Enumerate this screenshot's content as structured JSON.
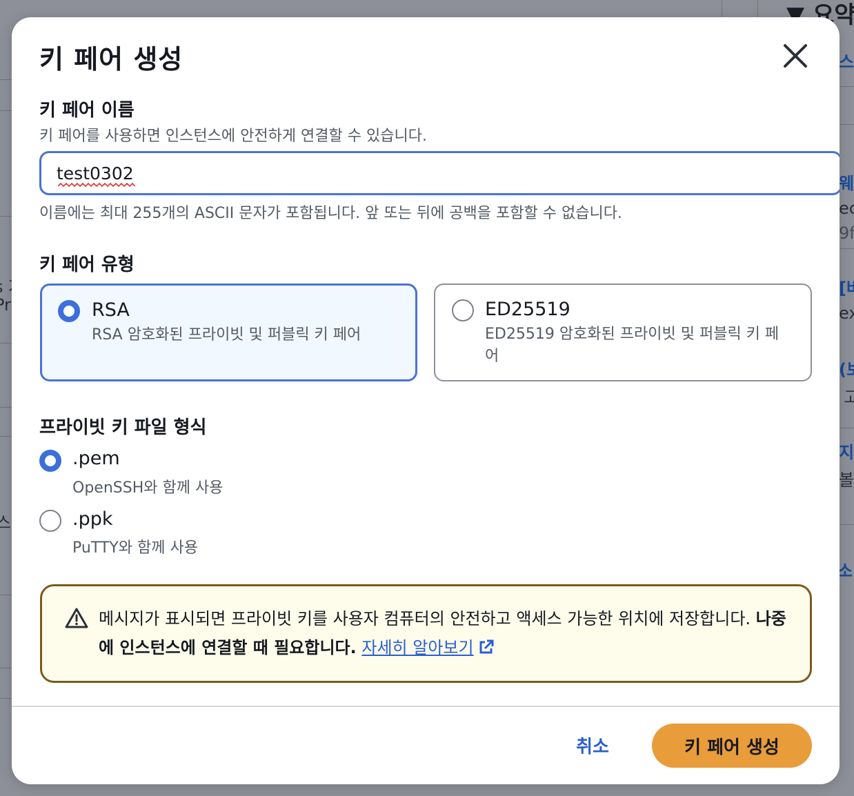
{
  "modal": {
    "title": "키 페어 생성",
    "name_section": {
      "label": "키 페어 이름",
      "description": "키 페어를 사용하면 인스턴스에 안전하게 연결할 수 있습니다.",
      "value": "test0302",
      "constraint": "이름에는 최대 255개의 ASCII 문자가 포함됩니다. 앞 또는 뒤에 공백을 포함할 수 없습니다."
    },
    "type_section": {
      "label": "키 페어 유형",
      "options": [
        {
          "title": "RSA",
          "description": "RSA 암호화된 프라이빗 및 퍼블릭 키 페어",
          "selected": true
        },
        {
          "title": "ED25519",
          "description": "ED25519 암호화된 프라이빗 및 퍼블릭 키 페어",
          "selected": false
        }
      ]
    },
    "format_section": {
      "label": "프라이빗 키 파일 형식",
      "options": [
        {
          "title": ".pem",
          "description": "OpenSSH와 함께 사용",
          "selected": true
        },
        {
          "title": ".ppk",
          "description": "PuTTY와 함께 사용",
          "selected": false
        }
      ]
    },
    "alert": {
      "text": "메시지가 표시되면 프라이빗 키를 사용자 컴퓨터의 안전하고 액세스 가능한 위치에 저장합니다.",
      "strong": "나중에 인스턴스에 연결할 때 필요합니다.",
      "link": "자세히 알아보기"
    },
    "footer": {
      "cancel_label": "취소",
      "create_label": "키 페어 생성"
    }
  },
  "background": {
    "fragments": [
      "▼ 요약",
      "스",
      "웨",
      "ec",
      "9f",
      "[버",
      "ex",
      "(보",
      "! 고",
      "지",
      "볼",
      "s 지",
      "Pr",
      "스",
      "소"
    ]
  },
  "colors": {
    "accent": "#3b6fd9",
    "primary_button": "#e89c3a",
    "warning_border": "#7a5a1c",
    "warning_bg": "#fefdec"
  }
}
